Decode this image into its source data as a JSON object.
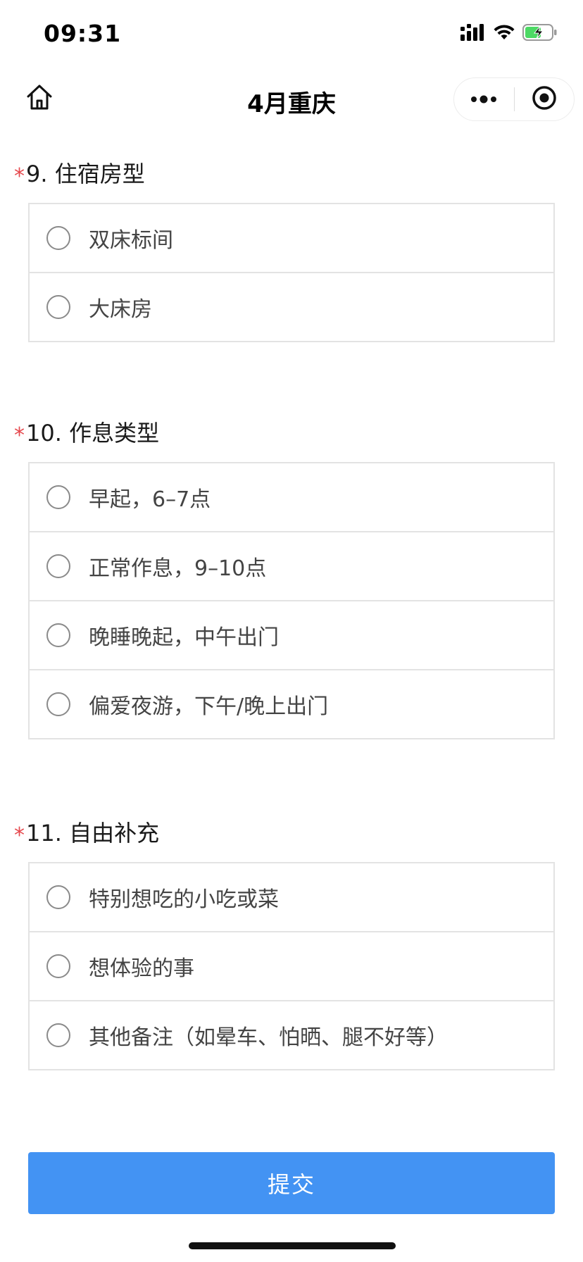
{
  "status_bar": {
    "time": "09:31",
    "battery_color": "#4cd964"
  },
  "nav": {
    "title": "4月重庆",
    "home_icon": "home-icon",
    "more_icon": "more-dots-icon",
    "close_icon": "target-close-icon"
  },
  "questions": [
    {
      "required_mark": "*",
      "title": "9. 住宿房型",
      "options": [
        "双床标间",
        "大床房"
      ]
    },
    {
      "required_mark": "*",
      "title": "10. 作息类型",
      "options": [
        "早起，6–7点",
        "正常作息，9–10点",
        "晚睡晚起，中午出门",
        "偏爱夜游，下午/晚上出门"
      ]
    },
    {
      "required_mark": "*",
      "title": "11. 自由补充",
      "options": [
        "特别想吃的小吃或菜",
        "想体验的事",
        "其他备注（如晕车、怕晒、腿不好等）"
      ]
    }
  ],
  "submit": {
    "label": "提交",
    "color": "#4393f3"
  },
  "colors": {
    "required_star": "#e5484d",
    "border": "#e3e3e3"
  }
}
